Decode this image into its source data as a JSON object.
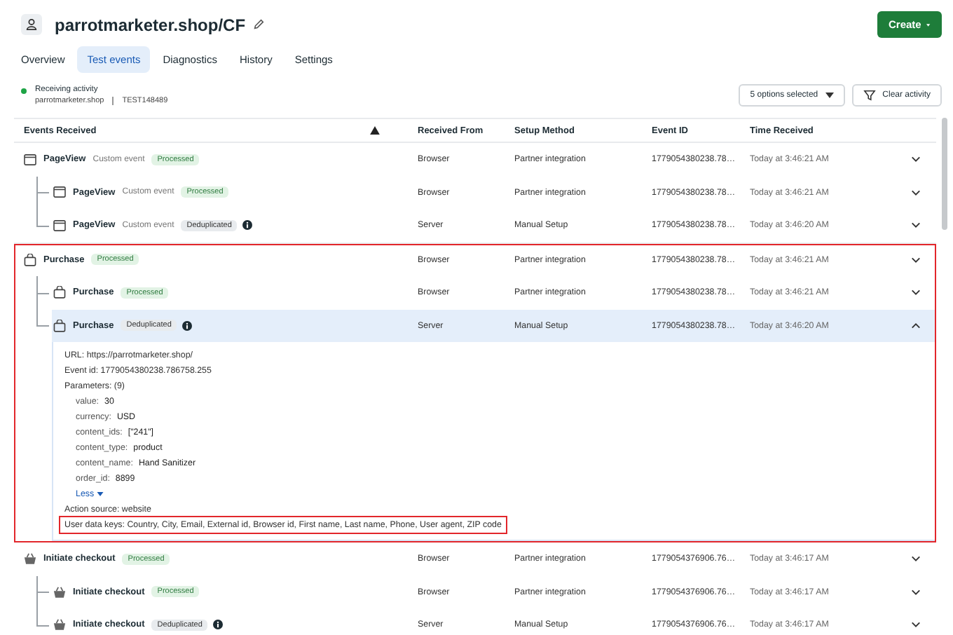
{
  "header": {
    "title": "parrotmarketer.shop/CF",
    "create_label": "Create"
  },
  "tabs": [
    {
      "label": "Overview",
      "selected": false
    },
    {
      "label": "Test events",
      "selected": true
    },
    {
      "label": "Diagnostics",
      "selected": false
    },
    {
      "label": "History",
      "selected": false
    },
    {
      "label": "Settings",
      "selected": false
    }
  ],
  "activity": {
    "label": "Receiving activity",
    "live": true,
    "site": "parrotmarketer.shop",
    "test_code": "TEST148489"
  },
  "filter": {
    "label": "5 options selected"
  },
  "clear_label": "Clear activity",
  "columns": [
    {
      "kind": "text",
      "label": "Events Received"
    },
    {
      "kind": "warning"
    },
    {
      "kind": "text",
      "label": "Received From"
    },
    {
      "kind": "text",
      "label": "Setup Method"
    },
    {
      "kind": "text",
      "label": "Event ID"
    },
    {
      "kind": "text",
      "label": "Time Received"
    }
  ],
  "groups": [
    {
      "highlighted": false,
      "event": {
        "kind": "page",
        "name": "PageView",
        "subtitle": "Custom event",
        "status": "Processed",
        "info": false,
        "received_from": "Browser",
        "setup_method": "Partner integration",
        "event_id": "1779054380238.78…",
        "time": "Today at 3:46:21 AM",
        "expanded": false,
        "selected": false,
        "children": [
          {
            "kind": "page",
            "name": "PageView",
            "subtitle": "Custom event",
            "status": "Processed",
            "info": false,
            "received_from": "Browser",
            "setup_method": "Partner integration",
            "event_id": "1779054380238.78…",
            "time": "Today at 3:46:21 AM",
            "expanded": false,
            "selected": false
          },
          {
            "kind": "page",
            "name": "PageView",
            "subtitle": "Custom event",
            "status": "Deduplicated",
            "info": true,
            "received_from": "Server",
            "setup_method": "Manual Setup",
            "event_id": "1779054380238.78…",
            "time": "Today at 3:46:20 AM",
            "expanded": false,
            "selected": false
          }
        ]
      }
    },
    {
      "highlighted": true,
      "event": {
        "kind": "bag",
        "name": "Purchase",
        "status": "Processed",
        "info": false,
        "received_from": "Browser",
        "setup_method": "Partner integration",
        "event_id": "1779054380238.78…",
        "time": "Today at 3:46:21 AM",
        "expanded": false,
        "selected": false,
        "children": [
          {
            "kind": "bag",
            "name": "Purchase",
            "status": "Processed",
            "info": false,
            "received_from": "Browser",
            "setup_method": "Partner integration",
            "event_id": "1779054380238.78…",
            "time": "Today at 3:46:21 AM",
            "expanded": false,
            "selected": false
          },
          {
            "kind": "bag",
            "name": "Purchase",
            "status": "Deduplicated",
            "info": true,
            "received_from": "Server",
            "setup_method": "Manual Setup",
            "event_id": "1779054380238.78…",
            "time": "Today at 3:46:20 AM",
            "expanded": true,
            "selected": true,
            "detail": {
              "url": "URL: https://parrotmarketer.shop/",
              "event_id": "Event id: 1779054380238.786758.255",
              "parameters_label": "Parameters: (9)",
              "parameters": [
                {
                  "key": "value:",
                  "value": "30"
                },
                {
                  "key": "currency:",
                  "value": "USD"
                },
                {
                  "key": "content_ids:",
                  "value": "[\"241\"]"
                },
                {
                  "key": "content_type:",
                  "value": "product"
                },
                {
                  "key": "content_name:",
                  "value": "Hand Sanitizer"
                },
                {
                  "key": "order_id:",
                  "value": "8899"
                }
              ],
              "less_label": "Less",
              "action_source": "Action source: website",
              "user_data": {
                "text": "User data keys: Country, City, Email, External id, Browser id, First name, Last name, Phone, User agent, ZIP code",
                "highlighted": true
              }
            }
          }
        ]
      }
    },
    {
      "highlighted": false,
      "event": {
        "kind": "basket",
        "name": "Initiate checkout",
        "status": "Processed",
        "info": false,
        "received_from": "Browser",
        "setup_method": "Partner integration",
        "event_id": "1779054376906.76…",
        "time": "Today at 3:46:17 AM",
        "expanded": false,
        "selected": false,
        "children": [
          {
            "kind": "basket",
            "name": "Initiate checkout",
            "status": "Processed",
            "info": false,
            "received_from": "Browser",
            "setup_method": "Partner integration",
            "event_id": "1779054376906.76…",
            "time": "Today at 3:46:17 AM",
            "expanded": false,
            "selected": false
          },
          {
            "kind": "basket",
            "name": "Initiate checkout",
            "status": "Deduplicated",
            "info": true,
            "received_from": "Server",
            "setup_method": "Manual Setup",
            "event_id": "1779054376906.76…",
            "time": "Today at 3:46:17 AM",
            "expanded": false,
            "selected": false
          }
        ]
      }
    }
  ]
}
